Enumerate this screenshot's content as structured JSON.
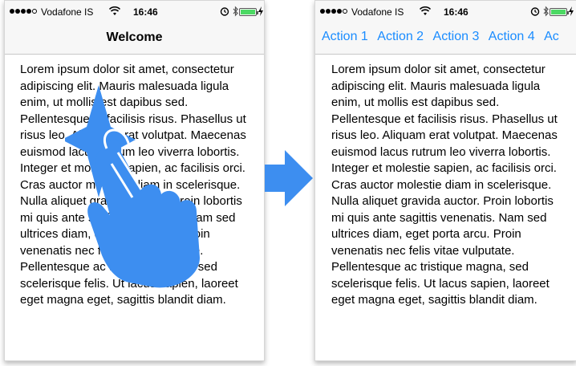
{
  "colors": {
    "accent": "#1a8cff",
    "gesture": "#3d8ef0",
    "bar_background": "#f7f7f7",
    "battery": "#4cd964"
  },
  "status_bar": {
    "carrier": "Vodafone IS",
    "time": "16:46"
  },
  "left_screen": {
    "title": "Welcome",
    "body": "Lorem ipsum dolor sit amet, consectetur adipiscing elit. Mauris malesuada ligula enim, ut mollis est dapibus sed. Pellentesque et facilisis risus. Phasellus ut risus leo. Aliquam erat volutpat. Maecenas euismod lacus rutrum leo viverra lobortis. Integer et molestie sapien, ac facilisis orci. Cras auctor molestie diam in scelerisque. Nulla aliquet gravida auctor. Proin lobortis mi quis ante sagittis venenatis. Nam sed ultrices diam, eget porta arcu. Proin venenatis nec felis vitae vulputate. Pellentesque ac tristique magna, sed scelerisque felis. Ut lacus sapien, laoreet eget magna eget, sagittis blandit diam."
  },
  "right_screen": {
    "actions": [
      "Action 1",
      "Action 2",
      "Action 3",
      "Action 4",
      "Ac"
    ],
    "body": "Lorem ipsum dolor sit amet, consectetur adipiscing elit. Mauris malesuada ligula enim, ut mollis est dapibus sed. Pellentesque et facilisis risus. Phasellus ut risus leo. Aliquam erat volutpat. Maecenas euismod lacus rutrum leo viverra lobortis. Integer et molestie sapien, ac facilisis orci. Cras auctor molestie diam in scelerisque. Nulla aliquet gravida auctor. Proin lobortis mi quis ante sagittis venenatis. Nam sed ultrices diam, eget porta arcu. Proin venenatis nec felis vitae vulputate. Pellentesque ac tristique magna, sed scelerisque felis. Ut lacus sapien, laoreet eget magna eget, sagittis blandit diam."
  },
  "icons": {
    "signal": "signal-dots-icon",
    "wifi": "wifi-icon",
    "alarm": "alarm-clock-icon",
    "bluetooth": "bluetooth-icon",
    "battery": "battery-icon",
    "charging": "charging-bolt-icon",
    "transition": "arrow-right-icon",
    "gesture": "tap-hand-icon"
  }
}
